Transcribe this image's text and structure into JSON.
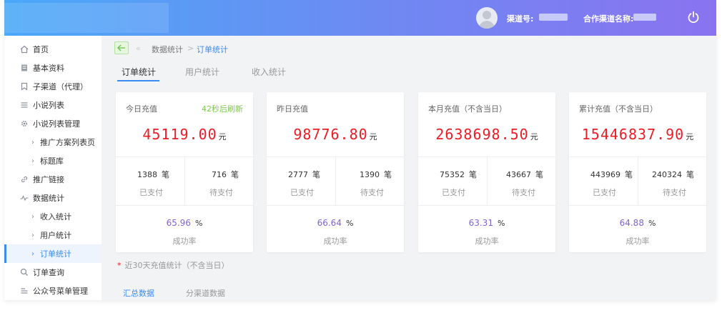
{
  "header": {
    "channel_no_label": "渠道号:",
    "partner_name_label": "合作渠道名称:"
  },
  "sidebar": {
    "items": [
      {
        "label": "首页",
        "icon": "home-icon"
      },
      {
        "label": "基本资料",
        "icon": "doc-icon"
      },
      {
        "label": "子渠道（代理）",
        "icon": "bookmark-icon"
      },
      {
        "label": "小说列表",
        "icon": "list-icon"
      },
      {
        "label": "小说列表管理",
        "icon": "gear-icon"
      },
      {
        "label": "推广方案列表页",
        "icon": "chevron-right-icon"
      },
      {
        "label": "标题库",
        "icon": "chevron-right-icon"
      },
      {
        "label": "推广链接",
        "icon": "link-icon"
      },
      {
        "label": "数据统计",
        "icon": "pulse-icon"
      },
      {
        "label": "收入统计",
        "icon": "chevron-right-icon"
      },
      {
        "label": "用户统计",
        "icon": "chevron-right-icon"
      },
      {
        "label": "订单统计",
        "icon": "chevron-right-icon"
      },
      {
        "label": "订单查询",
        "icon": "search-icon"
      },
      {
        "label": "公众号菜单管理",
        "icon": "menu-icon"
      }
    ]
  },
  "breadcrumb": {
    "parent": "数据统计",
    "separator": ">",
    "current": "订单统计"
  },
  "tabs": [
    "订单统计",
    "用户统计",
    "收入统计"
  ],
  "cards": [
    {
      "title": "今日充值",
      "refresh": "42秒后刷新",
      "amount": "45119.00",
      "unit": "元",
      "paid": "1388",
      "pending": "716",
      "count_unit": "笔",
      "paid_label": "已支付",
      "pending_label": "待支付",
      "rate": "65.96",
      "rate_unit": "%",
      "rate_label": "成功率"
    },
    {
      "title": "昨日充值",
      "amount": "98776.80",
      "unit": "元",
      "paid": "2777",
      "pending": "1390",
      "count_unit": "笔",
      "paid_label": "已支付",
      "pending_label": "待支付",
      "rate": "66.64",
      "rate_unit": "%",
      "rate_label": "成功率"
    },
    {
      "title": "本月充值（不含当日）",
      "amount": "2638698.50",
      "unit": "元",
      "paid": "75352",
      "pending": "43667",
      "count_unit": "笔",
      "paid_label": "已支付",
      "pending_label": "待支付",
      "rate": "63.31",
      "rate_unit": "%",
      "rate_label": "成功率"
    },
    {
      "title": "累计充值（不含当日）",
      "amount": "15446837.90",
      "unit": "元",
      "paid": "443969",
      "pending": "240324",
      "count_unit": "笔",
      "paid_label": "已支付",
      "pending_label": "待支付",
      "rate": "64.88",
      "rate_unit": "%",
      "rate_label": "成功率"
    }
  ],
  "note": {
    "star": "*",
    "text": "近30天充值统计（不含当日）"
  },
  "subtabs": [
    "汇总数据",
    "分渠道数据"
  ],
  "colors": {
    "accent": "#3b8cf0",
    "amount": "#ee1c25",
    "rate": "#7f63d6",
    "refresh": "#7ac943"
  }
}
